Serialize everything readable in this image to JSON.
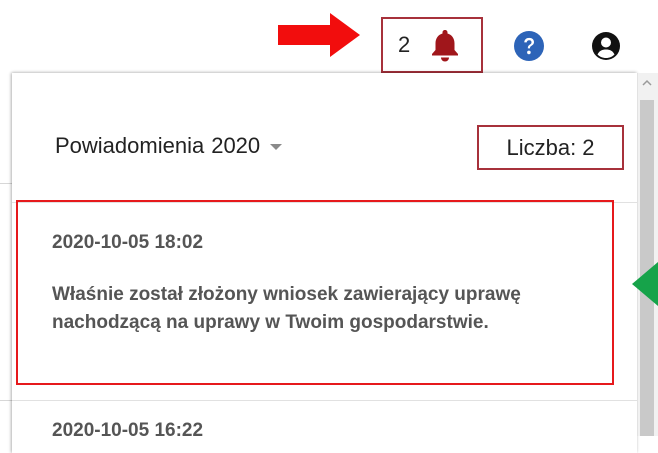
{
  "topbar": {
    "notification_count": "2",
    "icons": [
      "red-arrow",
      "bell-icon",
      "help-icon",
      "account-icon"
    ],
    "colors": {
      "bell": "#a0161b",
      "help": "#2d64b8",
      "annotation_red": "#e6191c",
      "annotation_border": "#a7313b"
    }
  },
  "panel": {
    "title": "Powiadomienia",
    "year": "2020",
    "count_label": "Liczba: 2",
    "items": [
      {
        "date": "2020-10-05 18:02",
        "text": "Właśnie został złożony wniosek zawierający uprawę nachodzącą na uprawy w Twoim gospodarstwie."
      },
      {
        "date": "2020-10-05 16:22"
      }
    ]
  }
}
